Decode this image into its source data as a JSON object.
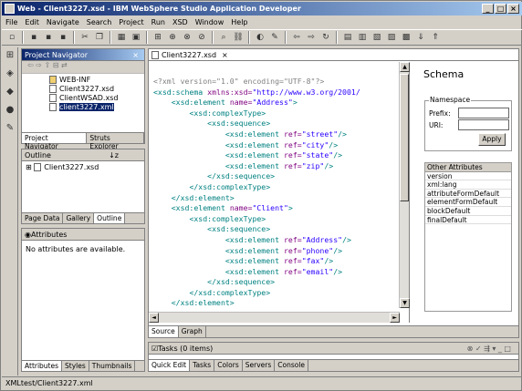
{
  "window": {
    "title": "Web - Client3227.xsd - IBM WebSphere Studio Application Developer",
    "min": "_",
    "max": "□",
    "close": "×"
  },
  "menu": [
    "File",
    "Edit",
    "Navigate",
    "Search",
    "Project",
    "Run",
    "XSD",
    "Window",
    "Help"
  ],
  "navigator": {
    "title": "Project Navigator",
    "items": [
      {
        "label": "WEB-INF",
        "type": "folder"
      },
      {
        "label": "Client3227.xsd",
        "type": "file"
      },
      {
        "label": "ClientWSAD.xsd",
        "type": "file"
      },
      {
        "label": "client3227.xml",
        "type": "file",
        "selected": true
      }
    ],
    "tabs": [
      "Project Navigator",
      "Struts Explorer"
    ]
  },
  "outline": {
    "title": "Outline",
    "items": [
      {
        "label": "Client3227.xsd"
      }
    ],
    "tabs": [
      "Page Data",
      "Gallery",
      "Outline"
    ]
  },
  "attributes": {
    "title": "Attributes",
    "message": "No attributes are available.",
    "tabs": [
      "Attributes",
      "Styles",
      "Thumbnails"
    ]
  },
  "editor": {
    "tab": "Client3227.xsd",
    "bottom_tabs": [
      "Source",
      "Graph"
    ]
  },
  "schema": {
    "title": "Schema",
    "namespace_legend": "Namespace",
    "prefix_label": "Prefix:",
    "uri_label": "URI:",
    "apply_label": "Apply",
    "other_header": "Other Attributes",
    "other_rows": [
      "version",
      "xml:lang",
      "attributeFormDefault",
      "elementFormDefault",
      "blockDefault",
      "finalDefault"
    ]
  },
  "tasks": {
    "title": "Tasks (0 items)",
    "tabs": [
      "Quick Edit",
      "Tasks",
      "Colors",
      "Servers",
      "Console"
    ]
  },
  "status": {
    "path": "XMLtest/Client3227.xml"
  }
}
